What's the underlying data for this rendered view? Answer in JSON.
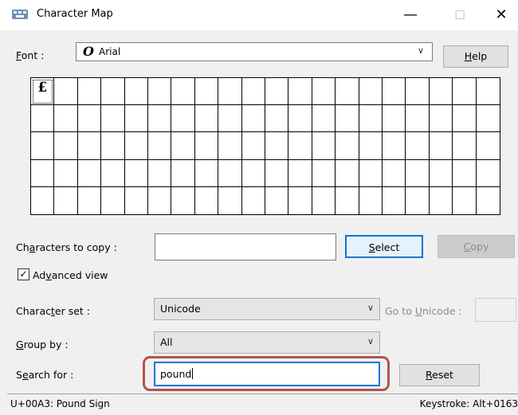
{
  "window": {
    "title": "Character Map",
    "icons": {
      "app": "character-map-icon",
      "minimize": "minimize-icon",
      "maximize": "maximize-icon",
      "close": "close-icon"
    }
  },
  "font": {
    "label_prefix": "",
    "label_accel": "F",
    "label_rest": "ont :",
    "value": "Arial",
    "type_icon_glyph": "O",
    "help_accel": "H",
    "help_rest": "elp"
  },
  "grid": {
    "columns": 20,
    "rows": 5,
    "characters": [
      "£"
    ],
    "selected_index": 0
  },
  "chars_to_copy": {
    "label_pre": "Ch",
    "label_accel": "a",
    "label_rest": "racters to copy :",
    "value": "",
    "select_accel": "S",
    "select_rest": "elect",
    "copy_accel": "C",
    "copy_rest": "opy"
  },
  "advanced_view": {
    "checked": true,
    "check_glyph": "✓",
    "label_pre": "Ad",
    "label_accel": "v",
    "label_rest": "anced view"
  },
  "character_set": {
    "label_pre": "Charac",
    "label_accel": "t",
    "label_rest": "er set :",
    "value": "Unicode",
    "goto_pre": "Go to ",
    "goto_accel": "U",
    "goto_rest": "nicode :",
    "goto_value": ""
  },
  "group_by": {
    "label_accel": "G",
    "label_rest": "roup by :",
    "value": "All"
  },
  "search": {
    "label_pre": "S",
    "label_accel": "e",
    "label_rest": "arch for :",
    "value": "pound",
    "reset_accel": "R",
    "reset_rest": "eset",
    "highlight_color": "#b5524e"
  },
  "status": {
    "left": "U+00A3: Pound Sign",
    "right": "Keystroke: Alt+0163"
  },
  "colors": {
    "focus_blue": "#0078d7",
    "dialog_bg": "#f0f0f0",
    "disabled_text": "#8b8b8b"
  }
}
